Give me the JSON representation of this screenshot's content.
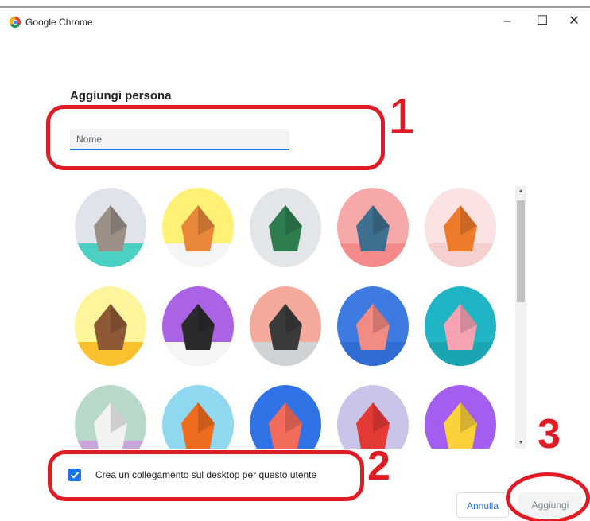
{
  "window": {
    "title": "Google Chrome",
    "minimize_glyph": "–",
    "maximize_glyph": "☐",
    "close_glyph": "✕"
  },
  "dialog": {
    "heading": "Aggiungi persona",
    "name_input": {
      "value": "",
      "placeholder": "Nome"
    },
    "avatars": [
      {
        "id": "cat",
        "bg": "#dfe3ea",
        "accent": "#9c8f86",
        "base": "#4dd0c4"
      },
      {
        "id": "corgi",
        "bg": "#fff176",
        "accent": "#e8873a",
        "base": "#f5f5f5"
      },
      {
        "id": "dragon",
        "bg": "#e3e6e8",
        "accent": "#2e7d4f",
        "base": "#e3e6e8"
      },
      {
        "id": "elephant",
        "bg": "#f7a8a8",
        "accent": "#3f6f8f",
        "base": "#f48a8a"
      },
      {
        "id": "fox",
        "bg": "#fbe3e3",
        "accent": "#ee7a2c",
        "base": "#f6cfcf"
      },
      {
        "id": "monkey",
        "bg": "#fff59d",
        "accent": "#8d5a35",
        "base": "#fbc02d"
      },
      {
        "id": "panda",
        "bg": "#ab63e6",
        "accent": "#2b2b2b",
        "base": "#f5f5f5"
      },
      {
        "id": "penguin",
        "bg": "#f4a99a",
        "accent": "#3a3a3a",
        "base": "#cfd3d6"
      },
      {
        "id": "butterfly",
        "bg": "#3d7be0",
        "accent": "#f28b82",
        "base": "#2f6cd3"
      },
      {
        "id": "rabbit",
        "bg": "#1fb5c4",
        "accent": "#f5a3b3",
        "base": "#1aa5b3"
      },
      {
        "id": "unicorn",
        "bg": "#b9d9c8",
        "accent": "#f2f2f2",
        "base": "#c7a6d9"
      },
      {
        "id": "basketball",
        "bg": "#8fd8ef",
        "accent": "#ee6c1f",
        "base": "#8fd8ef"
      },
      {
        "id": "bicycle",
        "bg": "#2f73e6",
        "accent": "#f26b5b",
        "base": "#2f73e6"
      },
      {
        "id": "bird",
        "bg": "#c9c4ea",
        "accent": "#e53935",
        "base": "#c9c4ea"
      },
      {
        "id": "cheese",
        "bg": "#a35ef0",
        "accent": "#fbd13b",
        "base": "#a35ef0"
      }
    ],
    "shortcut": {
      "checked": true,
      "label": "Crea un collegamento sul desktop per questo utente"
    },
    "buttons": {
      "cancel": "Annulla",
      "add": "Aggiungi"
    }
  },
  "annotations": {
    "step1": "1",
    "step2": "2",
    "step3": "3",
    "color": "#e01b24"
  },
  "colors": {
    "accent": "#1a73e8",
    "annotation": "#e01b24"
  }
}
